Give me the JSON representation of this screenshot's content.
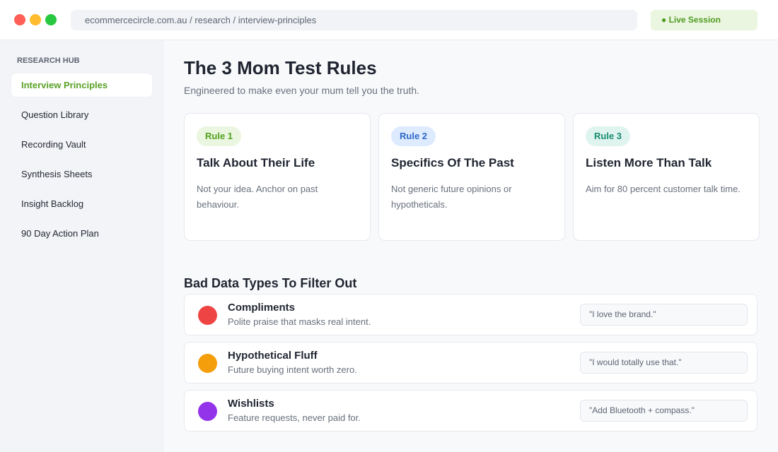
{
  "browser": {
    "url": "ecommercecircle.com.au / research / interview-principles",
    "session_label": "● Live Session",
    "controls": [
      {
        "name": "close-window-button",
        "color": "#ff5f57"
      },
      {
        "name": "minimize-window-button",
        "color": "#febc2e"
      },
      {
        "name": "maximize-window-button",
        "color": "#28c840"
      }
    ]
  },
  "sidebar": {
    "heading": "RESEARCH HUB",
    "items": [
      {
        "label": "Interview Principles",
        "active": true
      },
      {
        "label": "Question Library",
        "active": false
      },
      {
        "label": "Recording Vault",
        "active": false
      },
      {
        "label": "Synthesis Sheets",
        "active": false
      },
      {
        "label": "Insight Backlog",
        "active": false
      },
      {
        "label": "90 Day Action Plan",
        "active": false
      }
    ]
  },
  "main": {
    "title": "The 3 Mom Test Rules",
    "subtitle": "Engineered to make even your mum tell you the truth.",
    "rules": [
      {
        "badge": "Rule 1",
        "title": "Talk About Their Life",
        "body": "Not your idea. Anchor on past behaviour.",
        "badge_color": "#52a21f",
        "badge_background": "#eaf6df"
      },
      {
        "badge": "Rule 2",
        "title": "Specifics Of The Past",
        "body": "Not generic future opinions or hypotheticals.",
        "badge_color": "#2e69c8",
        "badge_background": "#deebff"
      },
      {
        "badge": "Rule 3",
        "title": "Listen More Than Talk",
        "body": "Aim for 80 percent customer talk time.",
        "badge_color": "#198b72",
        "badge_background": "#dff4ef"
      }
    ],
    "bad_data_title": "Bad Data Types To Filter Out",
    "bad_data_types": [
      {
        "title": "Compliments",
        "description": "Polite praise that masks real intent.",
        "quote": "\"I love the brand.\"",
        "color": "#ef4444",
        "icon": "red-status-dot-icon"
      },
      {
        "title": "Hypothetical Fluff",
        "description": "Future buying intent worth zero.",
        "quote": "\"I would totally use that.\"",
        "color": "#f59e0b",
        "icon": "orange-status-dot-icon"
      },
      {
        "title": "Wishlists",
        "description": "Feature requests, never paid for.",
        "quote": "\"Add Bluetooth + compass.\"",
        "color": "#9333ea",
        "icon": "purple-status-dot-icon"
      }
    ]
  }
}
